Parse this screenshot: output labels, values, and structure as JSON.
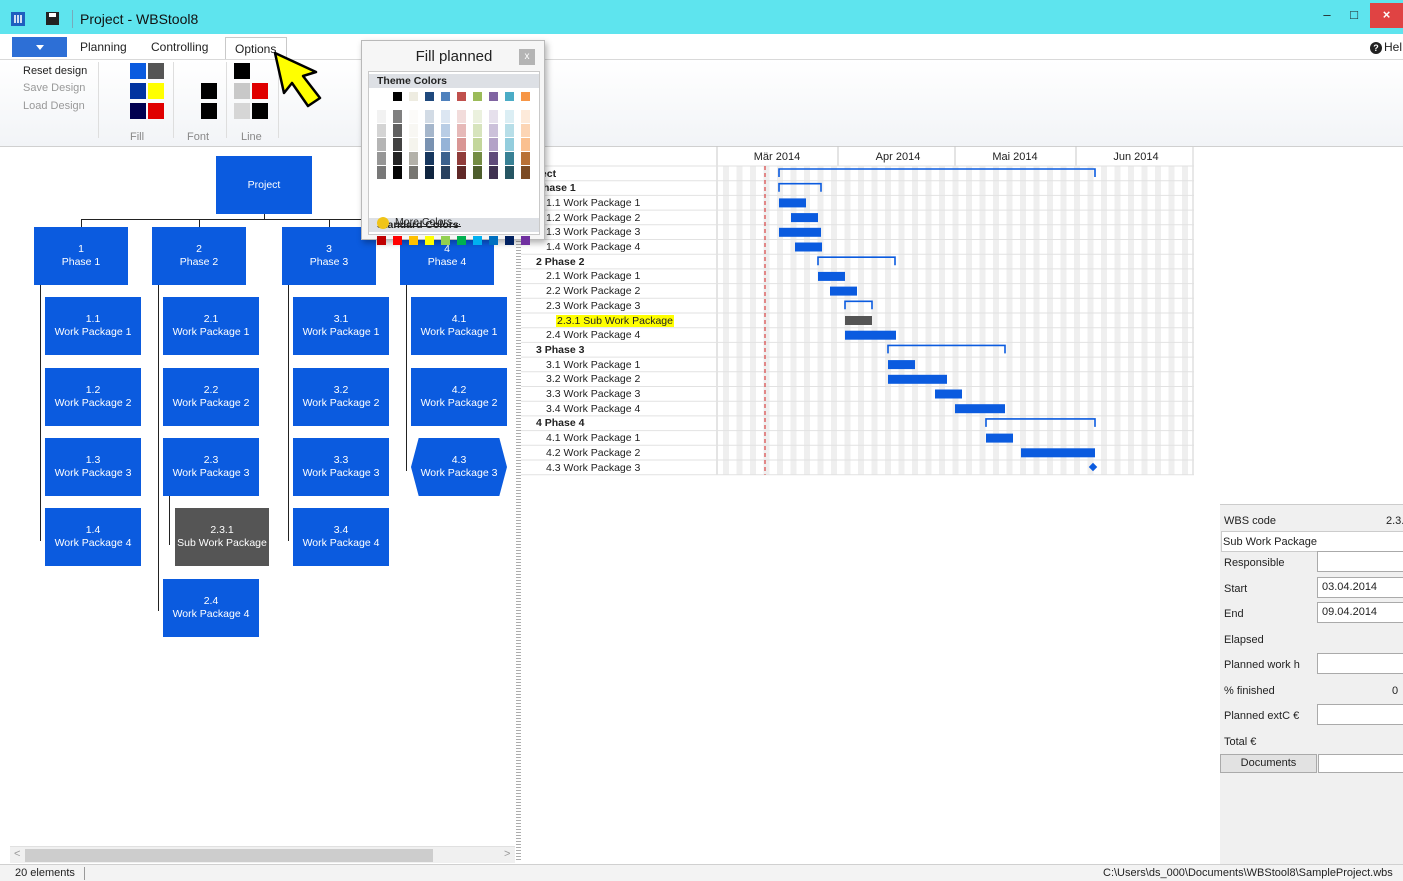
{
  "window": {
    "title": "Project - WBStool8",
    "minimize": "–",
    "maximize": "□",
    "close": "×"
  },
  "ribbon": {
    "tabs": [
      "Planning",
      "Controlling",
      "Options"
    ],
    "active_tab": "Options",
    "help": "Hel",
    "design_links": [
      "Reset design",
      "Save Design",
      "Load Design"
    ],
    "group_labels": [
      "Fill",
      "Font",
      "Line"
    ]
  },
  "popup": {
    "title": "Fill planned",
    "close": "x",
    "theme_colors_label": "Theme Colors",
    "standard_colors_label": "Standard Colors",
    "more_colors": "More Colors...",
    "theme_top_row": [
      "#ffffff",
      "#000000",
      "#eeece1",
      "#1f497d",
      "#4f81bd",
      "#c0504d",
      "#9bbb59",
      "#8064a2",
      "#4bacc6",
      "#f79646"
    ],
    "standard_colors": [
      "#c00000",
      "#ff0000",
      "#ffc000",
      "#ffff00",
      "#92d050",
      "#00b050",
      "#00b0f0",
      "#0070c0",
      "#002060",
      "#7030a0"
    ]
  },
  "wbs": {
    "root": {
      "code": "",
      "name": "Project"
    },
    "phases": [
      {
        "code": "1",
        "name": "Phase 1",
        "packages": [
          {
            "code": "1.1",
            "name": "Work Package 1"
          },
          {
            "code": "1.2",
            "name": "Work Package 2"
          },
          {
            "code": "1.3",
            "name": "Work Package 3"
          },
          {
            "code": "1.4",
            "name": "Work Package 4"
          }
        ]
      },
      {
        "code": "2",
        "name": "Phase 2",
        "packages": [
          {
            "code": "2.1",
            "name": "Work Package 1"
          },
          {
            "code": "2.2",
            "name": "Work Package 2"
          },
          {
            "code": "2.3",
            "name": "Work Package 3"
          },
          {
            "code": "2.4",
            "name": "Work Package 4"
          }
        ],
        "sub": {
          "code": "2.3.1",
          "name": "Sub Work Package"
        }
      },
      {
        "code": "3",
        "name": "Phase 3",
        "packages": [
          {
            "code": "3.1",
            "name": "Work Package 1"
          },
          {
            "code": "3.2",
            "name": "Work Package 2"
          },
          {
            "code": "3.3",
            "name": "Work Package 3"
          },
          {
            "code": "3.4",
            "name": "Work Package 4"
          }
        ]
      },
      {
        "code": "4",
        "name": "Phase 4",
        "packages": [
          {
            "code": "4.1",
            "name": "Work Package 1"
          },
          {
            "code": "4.2",
            "name": "Work Package 2"
          },
          {
            "code": "4.3",
            "name": "Work Package 3"
          }
        ]
      }
    ]
  },
  "gantt": {
    "months": [
      "Mär 2014",
      "Apr 2014",
      "Mai 2014",
      "Jun 2014"
    ],
    "rows": [
      {
        "label": "ject",
        "bold": true
      },
      {
        "label": "Phase 1",
        "bold": true
      },
      {
        "label": "1.1 Work Package 1"
      },
      {
        "label": "1.2 Work Package 2"
      },
      {
        "label": "1.3 Work Package 3"
      },
      {
        "label": "1.4 Work Package 4"
      },
      {
        "label": "2 Phase 2",
        "bold": true
      },
      {
        "label": "2.1 Work Package 1"
      },
      {
        "label": "2.2 Work Package 2"
      },
      {
        "label": "2.3 Work Package 3"
      },
      {
        "label": "2.3.1 Sub Work Package",
        "highlight": true
      },
      {
        "label": "2.4 Work Package 4"
      },
      {
        "label": "3 Phase 3",
        "bold": true
      },
      {
        "label": "3.1 Work Package 1"
      },
      {
        "label": "3.2 Work Package 2"
      },
      {
        "label": "3.3 Work Package 3"
      },
      {
        "label": "3.4 Work Package 4"
      },
      {
        "label": "4 Phase 4",
        "bold": true
      },
      {
        "label": "4.1 Work Package 1"
      },
      {
        "label": "4.2 Work Package 2"
      },
      {
        "label": "4.3 Work Package 3"
      }
    ]
  },
  "properties": {
    "wbs_code_label": "WBS code",
    "wbs_code_value": "2.3.",
    "name_value": "Sub Work Package",
    "responsible_label": "Responsible",
    "start_label": "Start",
    "start_value": "03.04.2014",
    "end_label": "End",
    "end_value": "09.04.2014",
    "elapsed_label": "Elapsed",
    "planned_work_label": "Planned work h",
    "finished_label": "% finished",
    "finished_value": "0",
    "planned_extc_label": "Planned extC €",
    "total_label": "Total €",
    "documents_label": "Documents"
  },
  "status": {
    "elements": "20 elements",
    "path": "C:\\Users\\ds_000\\Documents\\WBStool8\\SampleProject.wbs"
  },
  "colors": {
    "accent": "#0b5bdf",
    "titlebar": "#5ee4ee",
    "sub_package": "#555555",
    "highlight": "#ffff00"
  }
}
